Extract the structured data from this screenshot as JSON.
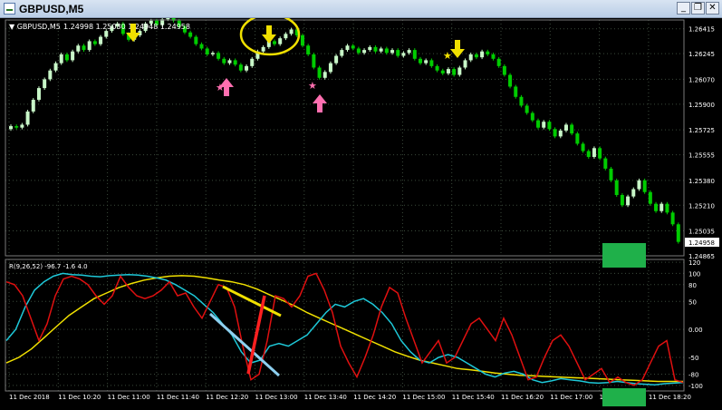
{
  "window": {
    "title": "GBPUSD,M5",
    "minimize_glyph": "_",
    "restore_glyph": "❐",
    "close_glyph": "✕"
  },
  "colors": {
    "background": "#000000",
    "grid": "#3b4a3b",
    "bull_candle": "#c8f7c8",
    "bear_candle": "#00cc00",
    "axis_text": "#ffffff",
    "line_red": "#e01010",
    "line_cyan": "#1ec8d8",
    "line_yellow": "#f0e000",
    "green_box": "#1fb04a"
  },
  "price_panel": {
    "symbol_label": "GBPUSD,M5",
    "ohlc_text": "1.24998 1.25030 1.24948 1.24958",
    "current_price": "1.24958",
    "price_ticks": [
      "1.26415",
      "1.26245",
      "1.26070",
      "1.25900",
      "1.25725",
      "1.25555",
      "1.25380",
      "1.25210",
      "1.25035",
      "1.24865"
    ]
  },
  "indicator_panel": {
    "label": "R(9,26,52) -96.7 -1.6 4.0",
    "ticks": [
      "120",
      "100",
      "80",
      "50",
      "0.00",
      "-50",
      "-80",
      "-100"
    ]
  },
  "time_axis": {
    "labels": [
      "11 Dec 2018",
      "11 Dec 10:20",
      "11 Dec 11:00",
      "11 Dec 11:40",
      "11 Dec 12:20",
      "11 Dec 13:00",
      "11 Dec 13:40",
      "11 Dec 14:20",
      "11 Dec 15:00",
      "11 Dec 15:40",
      "11 Dec 16:20",
      "11 Dec 17:00",
      "11 Dec 17:40",
      "11 Dec 18:20"
    ]
  },
  "chart_data": {
    "type": "candlestick",
    "price_ylim": [
      1.24865,
      1.26475
    ],
    "indicator_ylim": [
      -110,
      125
    ],
    "closes": [
      1.2575,
      1.2574,
      1.2576,
      1.2585,
      1.2593,
      1.2601,
      1.2607,
      1.2613,
      1.2618,
      1.2624,
      1.262,
      1.2626,
      1.263,
      1.2627,
      1.2633,
      1.2631,
      1.2636,
      1.264,
      1.2643,
      1.2645,
      1.2638,
      1.2634,
      1.2637,
      1.264,
      1.2645,
      1.2647,
      1.2644,
      1.2648,
      1.2651,
      1.2647,
      1.2643,
      1.2639,
      1.2636,
      1.2631,
      1.2628,
      1.2624,
      1.2625,
      1.2621,
      1.2618,
      1.262,
      1.2617,
      1.2613,
      1.2616,
      1.2621,
      1.2626,
      1.2629,
      1.2633,
      1.2631,
      1.2635,
      1.2638,
      1.2641,
      1.2637,
      1.263,
      1.2624,
      1.2615,
      1.2608,
      1.2612,
      1.2618,
      1.2623,
      1.2627,
      1.263,
      1.2628,
      1.2625,
      1.2627,
      1.2629,
      1.2626,
      1.2628,
      1.2625,
      1.2627,
      1.2623,
      1.2625,
      1.2627,
      1.2621,
      1.2618,
      1.262,
      1.2616,
      1.2613,
      1.2611,
      1.2614,
      1.261,
      1.2615,
      1.262,
      1.2624,
      1.2622,
      1.2626,
      1.2624,
      1.2621,
      1.2616,
      1.261,
      1.2602,
      1.2595,
      1.2589,
      1.2584,
      1.2579,
      1.2574,
      1.2578,
      1.2573,
      1.2568,
      1.2572,
      1.2576,
      1.257,
      1.2563,
      1.2558,
      1.2554,
      1.256,
      1.2553,
      1.2546,
      1.2538,
      1.2528,
      1.2521,
      1.2527,
      1.2532,
      1.2538,
      1.253,
      1.2522,
      1.2517,
      1.2522,
      1.2516,
      1.2508,
      1.2496
    ],
    "indicator_red": [
      85,
      80,
      60,
      20,
      -20,
      10,
      60,
      90,
      95,
      90,
      80,
      60,
      45,
      60,
      95,
      75,
      60,
      55,
      60,
      70,
      85,
      60,
      65,
      40,
      20,
      50,
      80,
      75,
      40,
      -30,
      -90,
      -80,
      -20,
      60,
      55,
      40,
      60,
      95,
      100,
      70,
      30,
      -30,
      -60,
      -85,
      -50,
      -10,
      40,
      75,
      65,
      20,
      -20,
      -60,
      -40,
      -20,
      -60,
      -50,
      -20,
      10,
      20,
      0,
      -20,
      20,
      -10,
      -50,
      -90,
      -85,
      -50,
      -20,
      -10,
      -30,
      -60,
      -90,
      -80,
      -70,
      -95,
      -85,
      -95,
      -100,
      -90,
      -60,
      -30,
      -20,
      -90,
      -95
    ],
    "indicator_cyan": [
      -20,
      0,
      40,
      70,
      85,
      95,
      100,
      98,
      97,
      95,
      94,
      96,
      97,
      98,
      97,
      95,
      92,
      88,
      80,
      70,
      60,
      45,
      30,
      10,
      -10,
      -40,
      -60,
      -55,
      -30,
      -25,
      -30,
      -20,
      -10,
      10,
      30,
      45,
      40,
      50,
      55,
      45,
      30,
      10,
      -20,
      -40,
      -55,
      -60,
      -50,
      -45,
      -50,
      -60,
      -70,
      -80,
      -85,
      -78,
      -75,
      -80,
      -90,
      -95,
      -92,
      -88,
      -90,
      -92,
      -95,
      -96,
      -95,
      -93,
      -95,
      -97,
      -98,
      -99,
      -97,
      -96,
      -95
    ],
    "indicator_yellow": [
      -60,
      -50,
      -35,
      -15,
      5,
      25,
      40,
      55,
      65,
      75,
      82,
      88,
      92,
      95,
      96,
      95,
      92,
      88,
      85,
      80,
      72,
      62,
      52,
      42,
      30,
      20,
      10,
      0,
      -10,
      -20,
      -30,
      -40,
      -48,
      -55,
      -60,
      -65,
      -70,
      -72,
      -75,
      -78,
      -80,
      -82,
      -83,
      -84,
      -85,
      -86,
      -87,
      -88,
      -89,
      -90,
      -91,
      -92,
      -93,
      -93,
      -93
    ],
    "series": [
      {
        "name": "R(9,26,52)",
        "values": []
      }
    ]
  }
}
